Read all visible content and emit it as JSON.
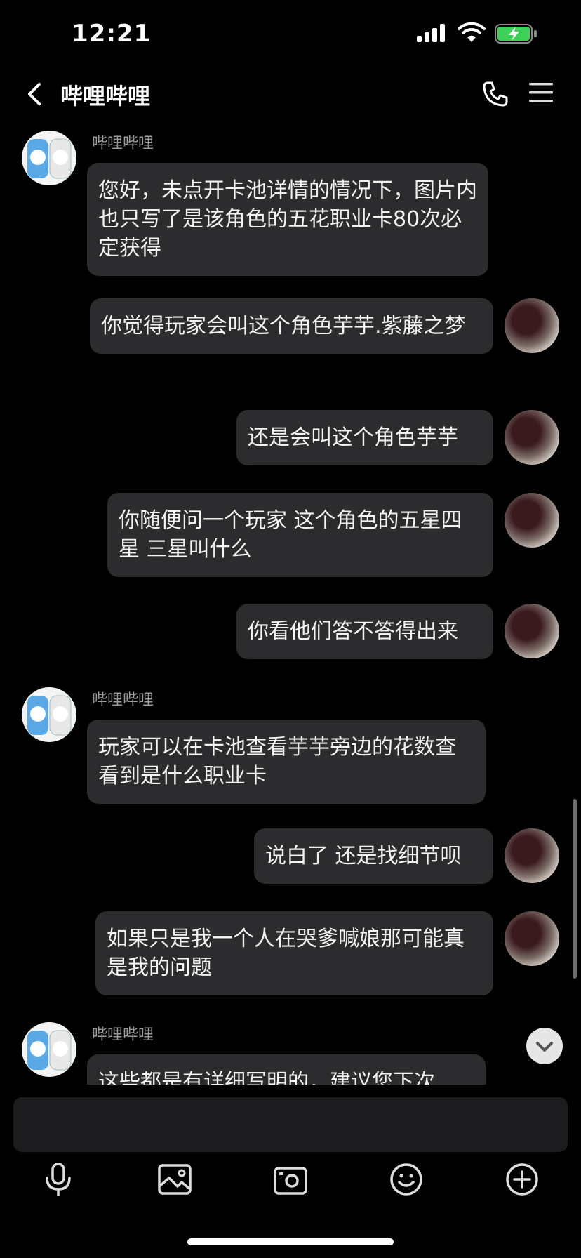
{
  "status_bar": {
    "time": "12:21"
  },
  "header": {
    "title": "哔哩哔哩"
  },
  "chat": {
    "messages": [
      {
        "from": "bot",
        "sender": "哔哩哔哩",
        "text": "您好，未点开卡池详情的情况下，图片内也只写了是该角色的五花职业卡80次必定获得"
      },
      {
        "from": "user",
        "text": "你觉得玩家会叫这个角色芋芋.紫藤之梦"
      },
      {
        "from": "user",
        "text": "还是会叫这个角色芋芋"
      },
      {
        "from": "user",
        "text": "你随便问一个玩家 这个角色的五星四星 三星叫什么"
      },
      {
        "from": "user",
        "text": "你看他们答不答得出来"
      },
      {
        "from": "bot",
        "sender": "哔哩哔哩",
        "text": "玩家可以在卡池查看芋芋旁边的花数查看到是什么职业卡"
      },
      {
        "from": "user",
        "text": "说白了 还是找细节呗"
      },
      {
        "from": "user",
        "text": "如果只是我一个人在哭爹喊娘那可能真是我的问题"
      },
      {
        "from": "bot",
        "sender": "哔哩哔哩",
        "text": "这些都是有详细写明的，建议您下次"
      }
    ]
  },
  "toolbar": {
    "icons": [
      "microphone-icon",
      "image-icon",
      "camera-icon",
      "emoji-icon",
      "plus-icon"
    ]
  }
}
